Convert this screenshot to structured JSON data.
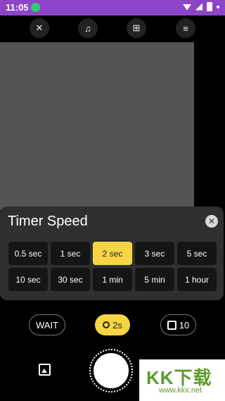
{
  "status_bar": {
    "time": "11:05",
    "icons": [
      "android-icon",
      "wifi-icon",
      "signal-icon",
      "battery-icon",
      "dot-icon"
    ]
  },
  "top_bar": {
    "icons": [
      "flash-off-icon",
      "volume-icon",
      "grid-icon",
      "menu-icon"
    ]
  },
  "timer_panel": {
    "title": "Timer Speed",
    "options": [
      "0.5 sec",
      "1 sec",
      "2 sec",
      "3 sec",
      "5 sec",
      "10 sec",
      "30 sec",
      "1 min",
      "5 min",
      "1 hour"
    ],
    "selected": "2 sec"
  },
  "chips": {
    "wait": "WAIT",
    "timer": "2s",
    "count": "10"
  },
  "watermark": {
    "main": "KK下载",
    "url": "www.kkx.net"
  },
  "colors": {
    "status_bar": "#8e44c8",
    "accent": "#f6d544",
    "panel": "#2f2f2f",
    "viewfinder": "#545454"
  }
}
